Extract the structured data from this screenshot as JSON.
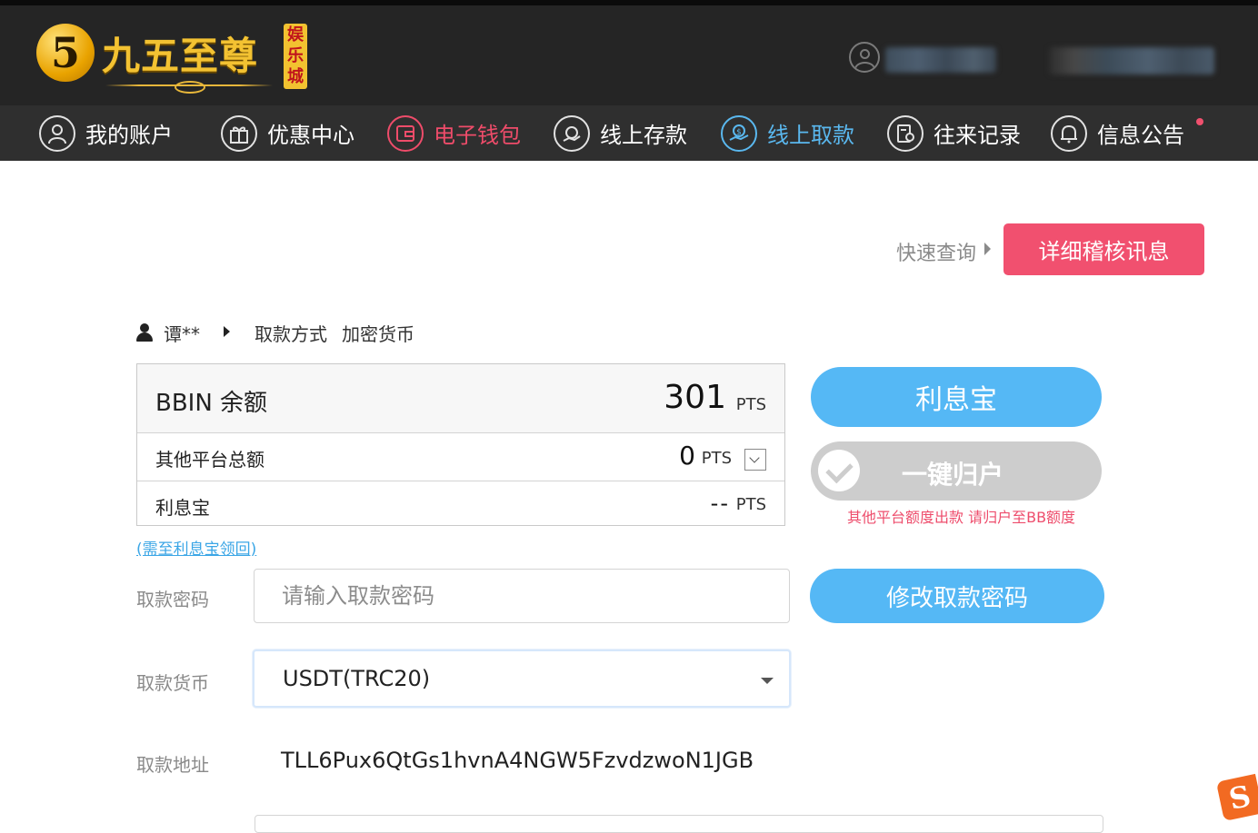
{
  "header": {
    "logo_mark": "5",
    "brand_name": "九五至尊",
    "brand_badge": "娱乐城"
  },
  "nav": {
    "items": [
      {
        "label": "我的账户",
        "icon": "user-circle-icon"
      },
      {
        "label": "优惠中心",
        "icon": "gift-icon"
      },
      {
        "label": "电子钱包",
        "icon": "wallet-icon",
        "state": "highlight-red"
      },
      {
        "label": "线上存款",
        "icon": "deposit-icon"
      },
      {
        "label": "线上取款",
        "icon": "withdraw-icon",
        "state": "active"
      },
      {
        "label": "往来记录",
        "icon": "records-icon"
      },
      {
        "label": "信息公告",
        "icon": "bell-icon",
        "badge": "unread-dot"
      }
    ]
  },
  "toolbar": {
    "quick_query_label": "快速查询",
    "audit_button_label": "详细稽核讯息"
  },
  "breadcrumb": {
    "user_name": "谭**",
    "method_label": "取款方式",
    "method_value": "加密货币"
  },
  "balances": {
    "bbin_label": "BBIN 余额",
    "bbin_amount": "301",
    "other_label": "其他平台总额",
    "other_amount": "0",
    "lixibao_label": "利息宝",
    "lixibao_amount": "--",
    "unit": "PTS",
    "collect_link": "(需至利息宝领回)"
  },
  "actions": {
    "lixibao_button": "利息宝",
    "onekey_button": "一键归户",
    "onekey_note": "其他平台额度出款 请归户至BB额度",
    "change_pwd_button": "修改取款密码"
  },
  "form": {
    "password_label": "取款密码",
    "password_placeholder": "请输入取款密码",
    "currency_label": "取款货币",
    "currency_value": "USDT(TRC20)",
    "address_label": "取款地址",
    "address_value": "TLL6Pux6QtGs1hvnA4NGW5FzvdzwoN1JGB"
  },
  "colors": {
    "accent_blue": "#55b8f5",
    "accent_red": "#f1506f",
    "header_bg": "#252525",
    "nav_bg": "#2f2f2f"
  }
}
